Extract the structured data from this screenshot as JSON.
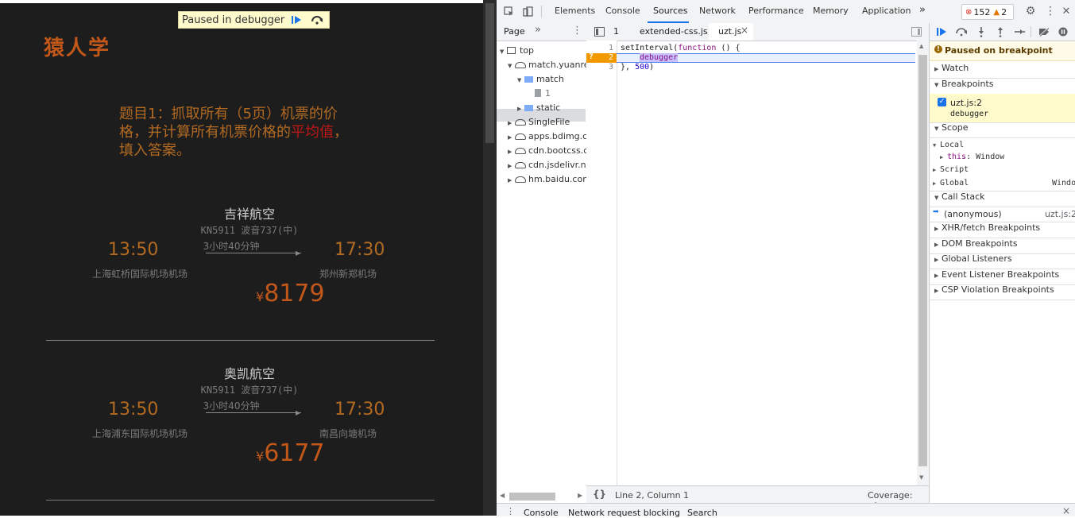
{
  "page": {
    "logo": "猿人学",
    "paused_overlay": {
      "label": "Paused in debugger"
    },
    "question": {
      "text_before": "题目1：抓取所有（5页）机票的价格，并计算所有机票价格的",
      "highlight": "平均值",
      "text_after": "，填入答案。"
    },
    "flights": [
      {
        "airline": "吉祥航空",
        "code": "KN5911 波音737(中)",
        "duration": "3小时40分钟",
        "dep_time": "13:50",
        "arr_time": "17:30",
        "dep_airport": "上海虹桥国际机场机场",
        "arr_airport": "郑州新郑机场",
        "currency": "¥",
        "price": "8179"
      },
      {
        "airline": "奥凯航空",
        "code": "KN5911 波音737(中)",
        "duration": "3小时40分钟",
        "dep_time": "13:50",
        "arr_time": "17:30",
        "dep_airport": "上海浦东国际机场机场",
        "arr_airport": "南昌向塘机场",
        "currency": "¥",
        "price": "6177"
      }
    ]
  },
  "devtools": {
    "tabs": [
      "Elements",
      "Console",
      "Sources",
      "Network",
      "Performance",
      "Memory",
      "Application"
    ],
    "active_tab": "Sources",
    "more_tabs": "»",
    "errors_count": "152",
    "warnings_count": "2",
    "navigator": {
      "tab": "Page",
      "more": "»",
      "tree": [
        {
          "label": "top"
        },
        {
          "label": "match.yuanrenxue.com"
        },
        {
          "label": "match"
        },
        {
          "label": "1"
        },
        {
          "label": "static"
        },
        {
          "label": "SingleFile"
        },
        {
          "label": "apps.bdimg.com"
        },
        {
          "label": "cdn.bootcss.com"
        },
        {
          "label": "cdn.jsdelivr.net"
        },
        {
          "label": "hm.baidu.com"
        }
      ]
    },
    "editor": {
      "tabs": [
        {
          "label": "1"
        },
        {
          "label": "extended-css.js"
        },
        {
          "label": "uzt.js"
        }
      ],
      "close_glyph": "×",
      "lines": [
        {
          "n": "1",
          "a": "setInterval(",
          "kw": "function",
          "b": " () {"
        },
        {
          "n": "2",
          "kw": "debugger"
        },
        {
          "n": "3",
          "a": "}, ",
          "num": "500",
          "b": ")"
        }
      ],
      "bp_marker": "?",
      "status": {
        "braces": "{}",
        "position": "Line 2, Column 1",
        "coverage": "Coverage: n/a"
      }
    },
    "sidebar": {
      "paused_label": "Paused on breakpoint",
      "watch": "Watch",
      "breakpoints": "Breakpoints",
      "bp_file": "uzt.js:2",
      "bp_code": "debugger",
      "scope": "Scope",
      "local": "Local",
      "this_key": "this",
      "this_val": "Window",
      "script": "Script",
      "global": "Global",
      "global_val": "Window",
      "call_stack": "Call Stack",
      "frame_name": "(anonymous)",
      "frame_loc": "uzt.js:2",
      "xhr": "XHR/fetch Breakpoints",
      "dom": "DOM Breakpoints",
      "global_listeners": "Global Listeners",
      "event_listener": "Event Listener Breakpoints",
      "csp": "CSP Violation Breakpoints"
    },
    "drawer": {
      "tabs": [
        "Console",
        "Network request blocking",
        "Search"
      ],
      "close_glyph": "×"
    }
  },
  "colors": {
    "accent": "#1a73e8",
    "page_bg": "#1d1d1d",
    "orange": "#c2571a",
    "highlight_red": "#c01616"
  }
}
